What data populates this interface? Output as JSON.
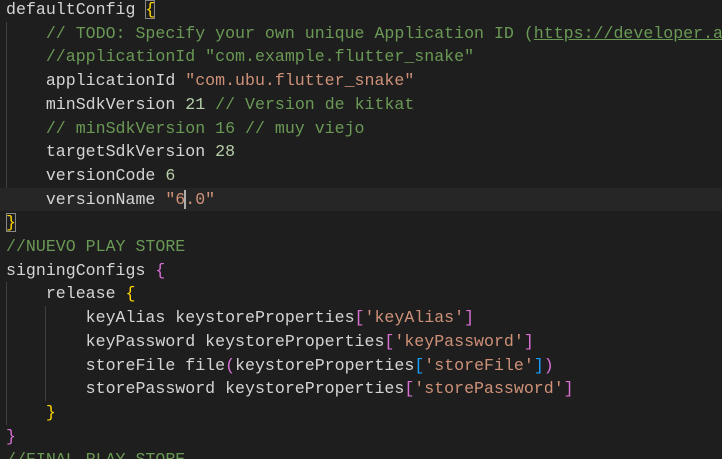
{
  "editor": {
    "colors": {
      "background": "#1e1e1e",
      "text": "#d4d4d4",
      "comment": "#6a9955",
      "string": "#ce9178",
      "number": "#b5cea8",
      "bracket_level1": "#ffd700",
      "bracket_level2": "#da70d6",
      "bracket_level3": "#179fff"
    },
    "lines": [
      {
        "indent": "",
        "tokens": [
          {
            "type": "plain",
            "text": "defaultConfig "
          },
          {
            "type": "brace1",
            "text": "{",
            "match": true
          }
        ]
      },
      {
        "indent": "    ",
        "tokens": [
          {
            "type": "comment",
            "text": "// TODO: Specify your own unique Application ID ("
          },
          {
            "type": "link",
            "text": "https://developer.android.com/studio/build/application-id.html"
          },
          {
            "type": "comment",
            "text": ")."
          }
        ]
      },
      {
        "indent": "    ",
        "tokens": [
          {
            "type": "comment",
            "text": "//applicationId \"com.example.flutter_snake\""
          }
        ]
      },
      {
        "indent": "    ",
        "tokens": [
          {
            "type": "plain",
            "text": "applicationId "
          },
          {
            "type": "string",
            "text": "\"com.ubu.flutter_snake\""
          }
        ]
      },
      {
        "indent": "    ",
        "tokens": [
          {
            "type": "plain",
            "text": "minSdkVersion "
          },
          {
            "type": "number",
            "text": "21"
          },
          {
            "type": "plain",
            "text": " "
          },
          {
            "type": "comment",
            "text": "// Version de kitkat"
          }
        ]
      },
      {
        "indent": "    ",
        "tokens": [
          {
            "type": "comment",
            "text": "// minSdkVersion 16 // muy viejo"
          }
        ]
      },
      {
        "indent": "    ",
        "tokens": [
          {
            "type": "plain",
            "text": "targetSdkVersion "
          },
          {
            "type": "number",
            "text": "28"
          }
        ]
      },
      {
        "indent": "    ",
        "tokens": [
          {
            "type": "plain",
            "text": "versionCode "
          },
          {
            "type": "number",
            "text": "6"
          }
        ]
      },
      {
        "indent": "    ",
        "current": true,
        "tokens": [
          {
            "type": "plain",
            "text": "versionName "
          },
          {
            "type": "string",
            "text": "\"6"
          },
          {
            "type": "cursor",
            "text": ""
          },
          {
            "type": "string",
            "text": ".0\""
          }
        ]
      },
      {
        "indent": "",
        "tokens": [
          {
            "type": "brace1",
            "text": "}",
            "match": true
          }
        ]
      },
      {
        "indent": "",
        "tokens": [
          {
            "type": "comment",
            "text": "//NUEVO PLAY STORE"
          }
        ]
      },
      {
        "indent": "",
        "tokens": [
          {
            "type": "plain",
            "text": "signingConfigs "
          },
          {
            "type": "brace2",
            "text": "{"
          }
        ]
      },
      {
        "indent": "    ",
        "tokens": [
          {
            "type": "plain",
            "text": "release "
          },
          {
            "type": "brace1",
            "text": "{"
          }
        ]
      },
      {
        "indent": "        ",
        "tokens": [
          {
            "type": "plain",
            "text": "keyAlias keystoreProperties"
          },
          {
            "type": "brace2",
            "text": "["
          },
          {
            "type": "string",
            "text": "'keyAlias'"
          },
          {
            "type": "brace2",
            "text": "]"
          }
        ]
      },
      {
        "indent": "        ",
        "tokens": [
          {
            "type": "plain",
            "text": "keyPassword keystoreProperties"
          },
          {
            "type": "brace2",
            "text": "["
          },
          {
            "type": "string",
            "text": "'keyPassword'"
          },
          {
            "type": "brace2",
            "text": "]"
          }
        ]
      },
      {
        "indent": "        ",
        "tokens": [
          {
            "type": "plain",
            "text": "storeFile file"
          },
          {
            "type": "brace2",
            "text": "("
          },
          {
            "type": "plain",
            "text": "keystoreProperties"
          },
          {
            "type": "brace3",
            "text": "["
          },
          {
            "type": "string",
            "text": "'storeFile'"
          },
          {
            "type": "brace3",
            "text": "]"
          },
          {
            "type": "brace2",
            "text": ")"
          }
        ]
      },
      {
        "indent": "        ",
        "tokens": [
          {
            "type": "plain",
            "text": "storePassword keystoreProperties"
          },
          {
            "type": "brace2",
            "text": "["
          },
          {
            "type": "string",
            "text": "'storePassword'"
          },
          {
            "type": "brace2",
            "text": "]"
          }
        ]
      },
      {
        "indent": "    ",
        "tokens": [
          {
            "type": "brace1",
            "text": "}"
          }
        ]
      },
      {
        "indent": "",
        "tokens": [
          {
            "type": "brace2",
            "text": "}"
          }
        ]
      },
      {
        "indent": "",
        "tokens": [
          {
            "type": "comment",
            "text": "//FINAL PLAY STORE"
          }
        ]
      }
    ]
  }
}
